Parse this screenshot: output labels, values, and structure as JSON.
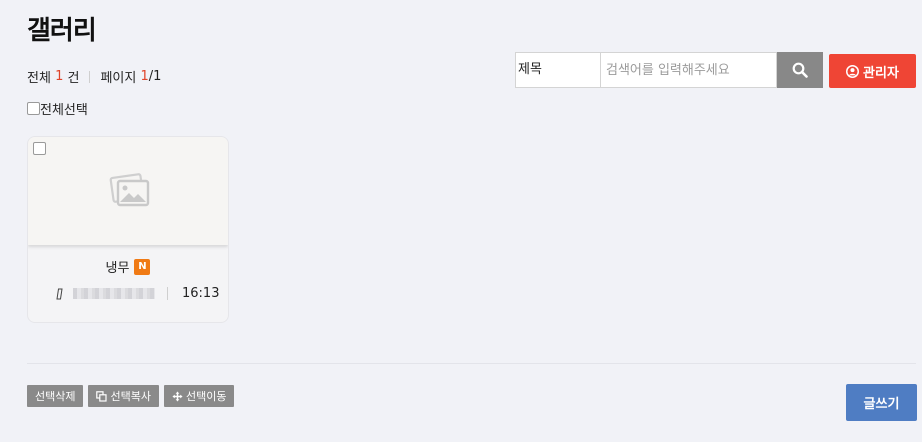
{
  "page": {
    "title": "갤러리"
  },
  "stats": {
    "total_label": "전체",
    "total_count": "1",
    "count_unit": "건",
    "page_label": "페이지",
    "page_current": "1",
    "page_total": "/1"
  },
  "select_all": {
    "label": "전체선택"
  },
  "search": {
    "field_selected": "제목",
    "placeholder": "검색어를 입력해주세요",
    "button_icon": "search-icon"
  },
  "admin_button": {
    "label": "관리자",
    "icon": "user-circle-icon"
  },
  "gallery": {
    "items": [
      {
        "title": "냉무",
        "badge": "N",
        "thumbnail_icon": "image-placeholder-icon",
        "author_icon": "phone-icon",
        "time": "16:13"
      }
    ]
  },
  "actions": {
    "delete_label": "선택삭제",
    "copy_label": "선택복사",
    "copy_icon": "copy-icon",
    "move_label": "선택이동",
    "move_icon": "move-arrows-icon",
    "write_label": "글쓰기"
  },
  "colors": {
    "background": "#f1f2f7",
    "accent_red": "#ef4535",
    "write_blue": "#4f7dc3",
    "badge_orange": "#f07a14",
    "gray_button": "#8a8a8a"
  }
}
